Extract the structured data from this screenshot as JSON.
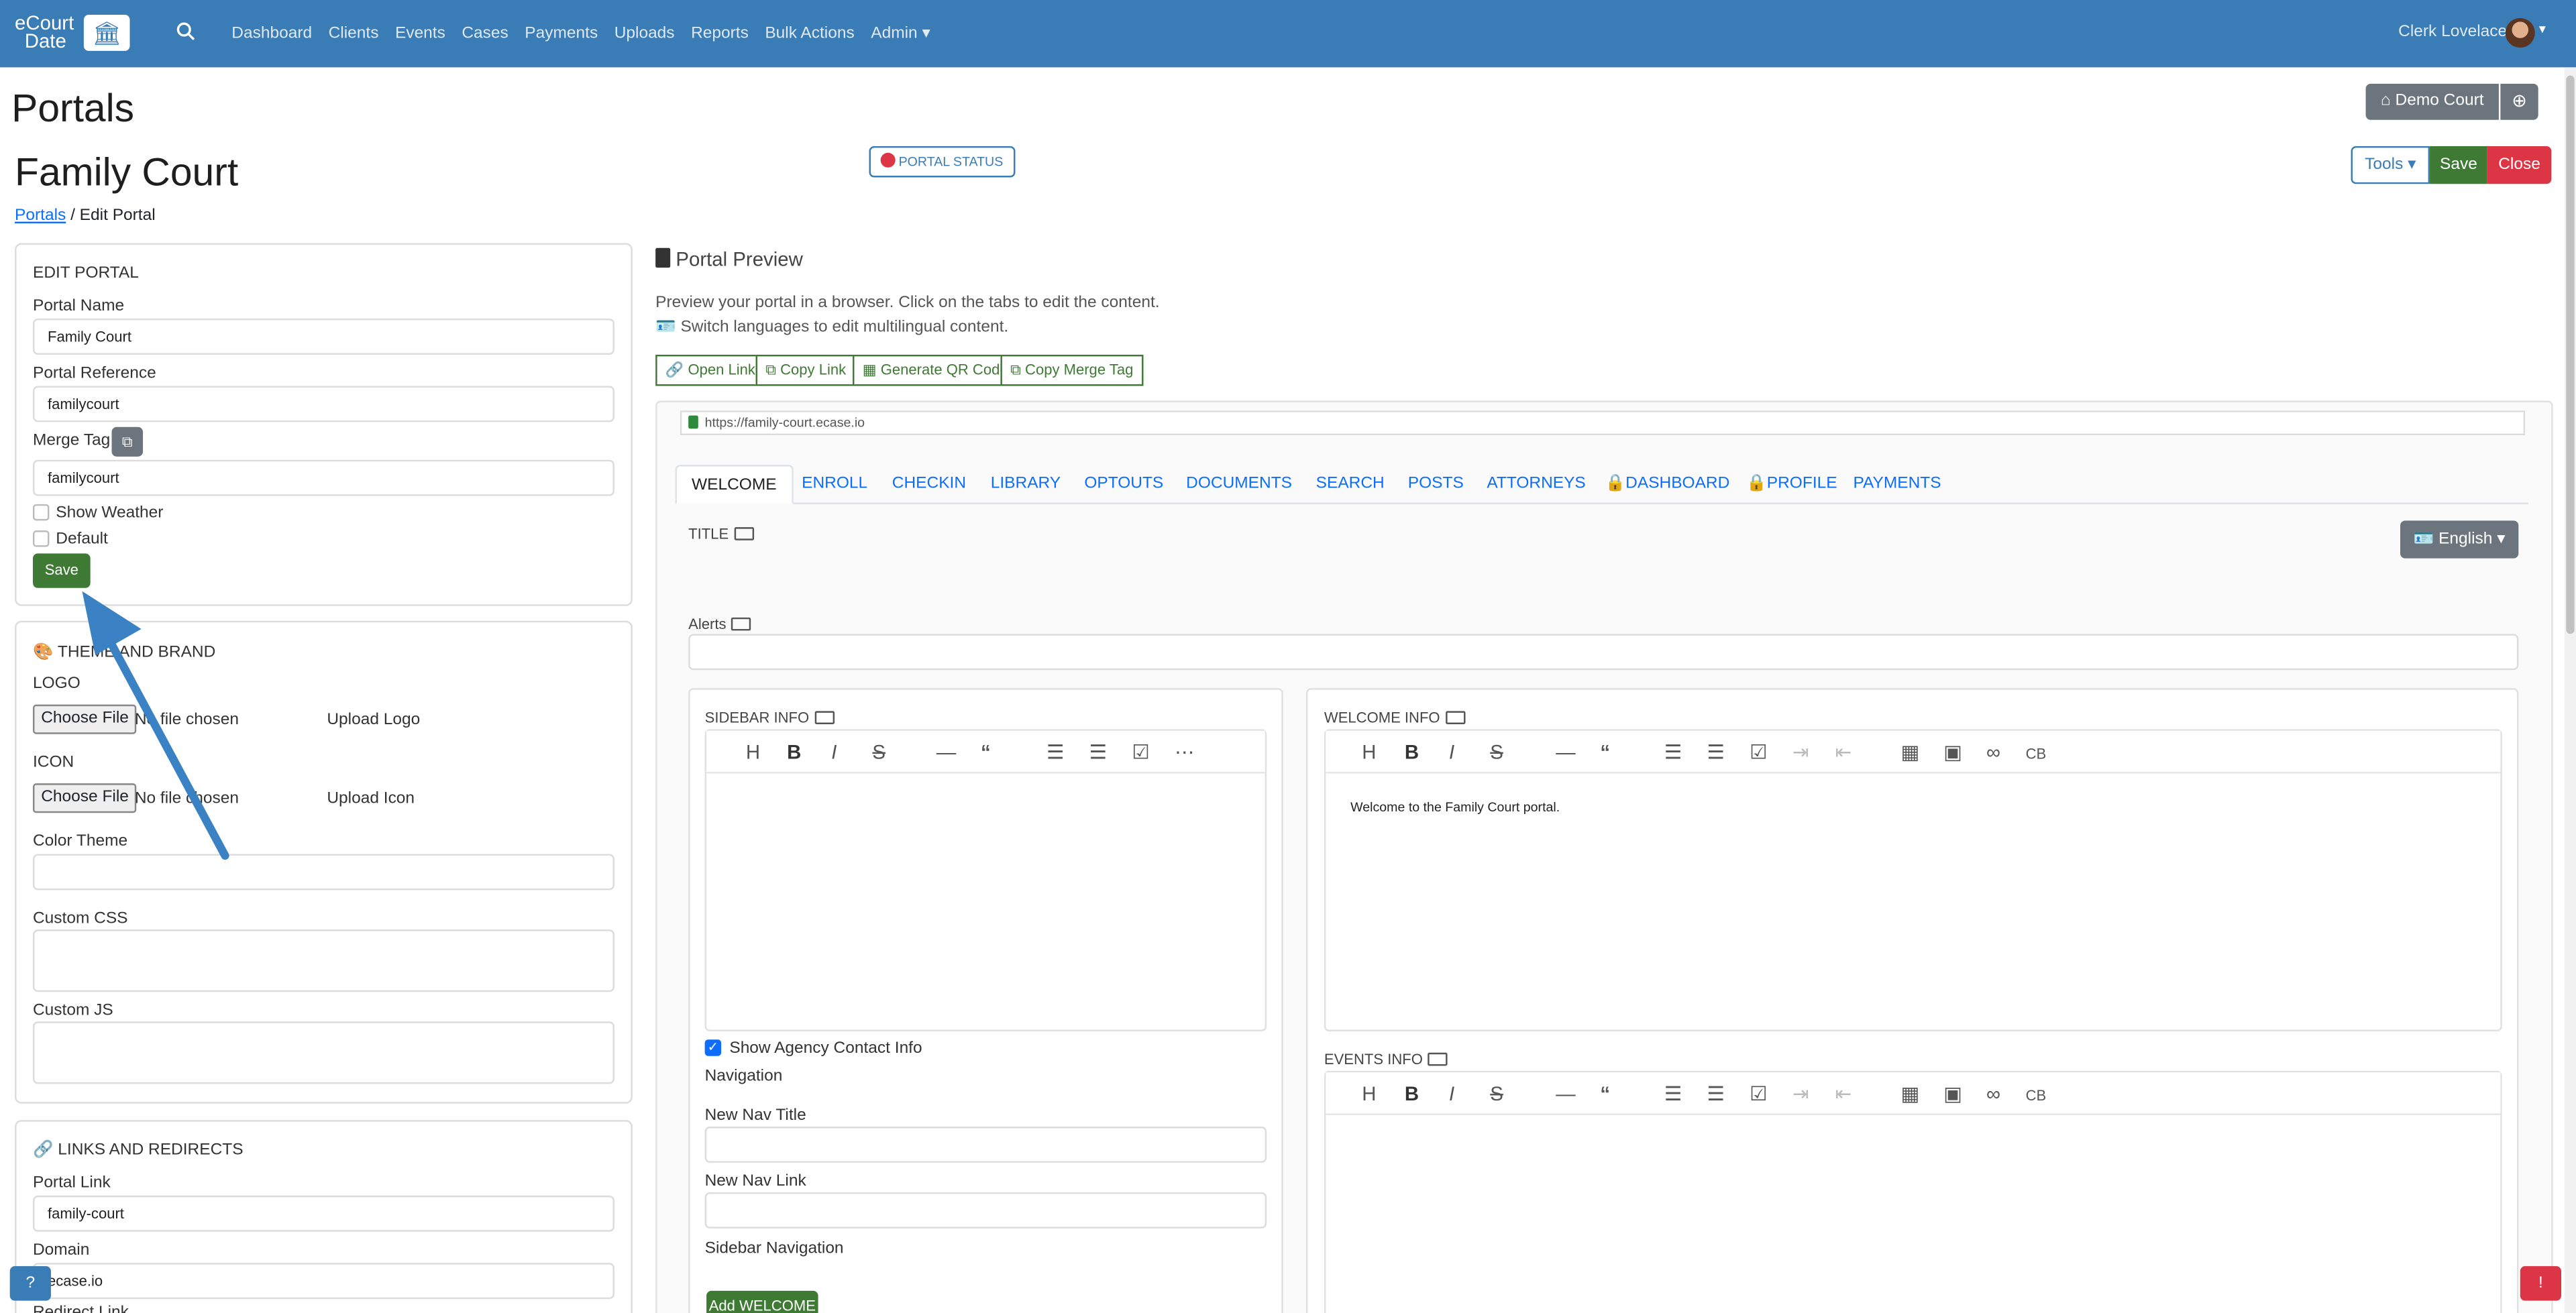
{
  "nav": {
    "brand_line1": "eCourt",
    "brand_line2": "Date",
    "links": [
      "Dashboard",
      "Clients",
      "Events",
      "Cases",
      "Payments",
      "Uploads",
      "Reports",
      "Bulk Actions",
      "Admin ▾"
    ],
    "user": "Clerk Lovelace"
  },
  "header": {
    "title": "Portals",
    "subtitle": "Family Court",
    "crumb_link": "Portals",
    "crumb_rest": "/ Edit Portal",
    "portal_status": "PORTAL STATUS",
    "demo_court": "Demo Court",
    "tools": "Tools ▾",
    "save": "Save",
    "close": "Close"
  },
  "edit": {
    "heading": "EDIT PORTAL",
    "name_label": "Portal Name",
    "name_value": "Family Court",
    "ref_label": "Portal Reference",
    "ref_value": "familycourt",
    "merge_label": "Merge Tag",
    "merge_value": "familycourt",
    "weather": "Show Weather",
    "default": "Default",
    "save": "Save"
  },
  "theme": {
    "heading": "THEME AND BRAND",
    "logo": "LOGO",
    "choose": "Choose File",
    "no_file": "No file chosen",
    "upload_logo": "Upload Logo",
    "icon": "ICON",
    "upload_icon": "Upload Icon",
    "color_theme": "Color Theme",
    "custom_css": "Custom CSS",
    "custom_js": "Custom JS"
  },
  "links": {
    "heading": "LINKS AND REDIRECTS",
    "portal_link_label": "Portal Link",
    "portal_link_value": "family-court",
    "domain_label": "Domain",
    "domain_value": "ecase.io",
    "redirect_label": "Redirect Link"
  },
  "preview": {
    "title": "Portal Preview",
    "line1": "Preview your portal in a browser. Click on the tabs to edit the content.",
    "line2": "Switch languages to edit multilingual content.",
    "btn_open": "Open Link",
    "btn_copy": "Copy Link",
    "btn_qr": "Generate QR Code",
    "btn_merge": "Copy Merge Tag",
    "url": "https://family-court.ecase.io"
  },
  "tabs": [
    "WELCOME",
    "ENROLL",
    "CHECKIN",
    "LIBRARY",
    "OPTOUTS",
    "DOCUMENTS",
    "SEARCH",
    "POSTS",
    "ATTORNEYS",
    "DASHBOARD",
    "PROFILE",
    "PAYMENTS"
  ],
  "content": {
    "title_label": "TITLE",
    "alerts_label": "Alerts",
    "language": "English ▾",
    "sidebar_info": "SIDEBAR INFO",
    "welcome_info": "WELCOME INFO",
    "welcome_text": "Welcome to the Family Court portal.",
    "events_info": "EVENTS INFO",
    "show_agency": "Show Agency Contact Info",
    "navigation": "Navigation",
    "new_nav_title": "New Nav Title",
    "new_nav_link": "New Nav Link",
    "sidebar_nav": "Sidebar Navigation",
    "add_welcome": "Add WELCOME"
  },
  "colors": {
    "navbar": "#3a7cb5",
    "success": "#3f7a35",
    "danger": "#dc3545"
  }
}
